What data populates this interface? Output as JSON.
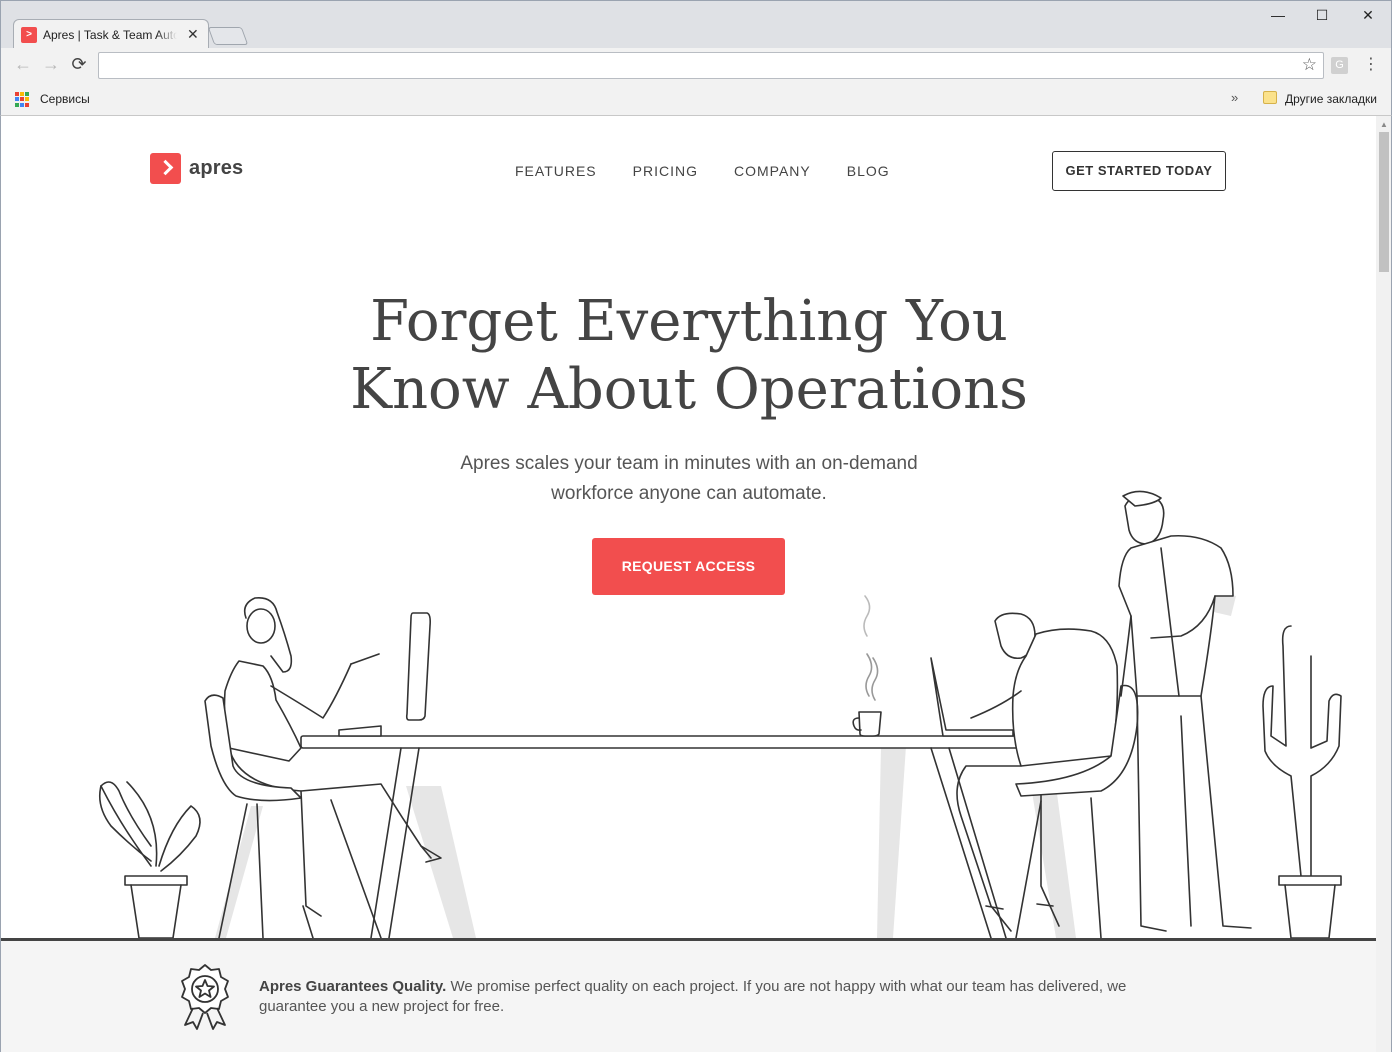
{
  "browser": {
    "tab_title": "Apres | Task & Team Automation",
    "tab_favicon_glyph": ">",
    "tab_close": "✕",
    "back_icon": "←",
    "forward_icon": "→",
    "reload_icon": "⟳",
    "address": "",
    "ext_label": "G",
    "bookmarks": {
      "apps_label": "Сервисы",
      "more_chevron": "»",
      "other_label": "Другие закладки"
    },
    "window_controls": {
      "minimize": "—",
      "maximize": "☐",
      "close": "✕"
    }
  },
  "site": {
    "logo_text": "apres",
    "nav": [
      {
        "label": "FEATURES"
      },
      {
        "label": "PRICING"
      },
      {
        "label": "COMPANY"
      },
      {
        "label": "BLOG"
      }
    ],
    "header_cta": "GET STARTED TODAY",
    "hero": {
      "title_line1": "Forget Everything You",
      "title_line2": "Know About Operations",
      "subtitle_line1": "Apres scales your team in minutes with an on-demand",
      "subtitle_line2": "workforce anyone can automate.",
      "cta": "REQUEST ACCESS"
    },
    "guarantee": {
      "title": "Apres Guarantees Quality.",
      "body": " We promise perfect quality on each project. If you are not happy with what our team has delivered, we guarantee you a new project for free."
    }
  },
  "colors": {
    "brand_red": "#f24e4e",
    "text_dark": "#444444",
    "footer_bg": "#f5f5f5"
  }
}
